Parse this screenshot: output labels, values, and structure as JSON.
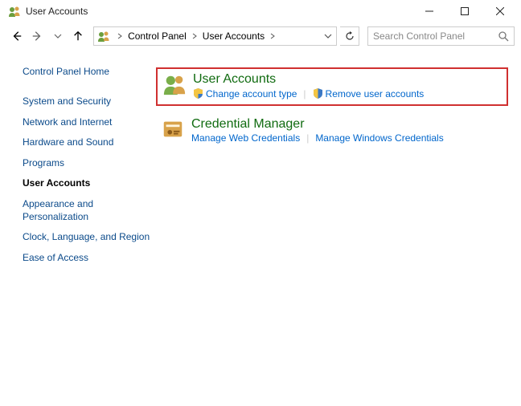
{
  "window": {
    "title": "User Accounts"
  },
  "breadcrumb": {
    "item1": "Control Panel",
    "item2": "User Accounts"
  },
  "search": {
    "placeholder": "Search Control Panel"
  },
  "sidebar": {
    "home": "Control Panel Home",
    "items": {
      "0": "System and Security",
      "1": "Network and Internet",
      "2": "Hardware and Sound",
      "3": "Programs",
      "4": "User Accounts",
      "5": "Appearance and Personalization",
      "6": "Clock, Language, and Region",
      "7": "Ease of Access"
    }
  },
  "content": {
    "cat1": {
      "title": "User Accounts",
      "link1": "Change account type",
      "link2": "Remove user accounts"
    },
    "cat2": {
      "title": "Credential Manager",
      "link1": "Manage Web Credentials",
      "link2": "Manage Windows Credentials"
    }
  }
}
